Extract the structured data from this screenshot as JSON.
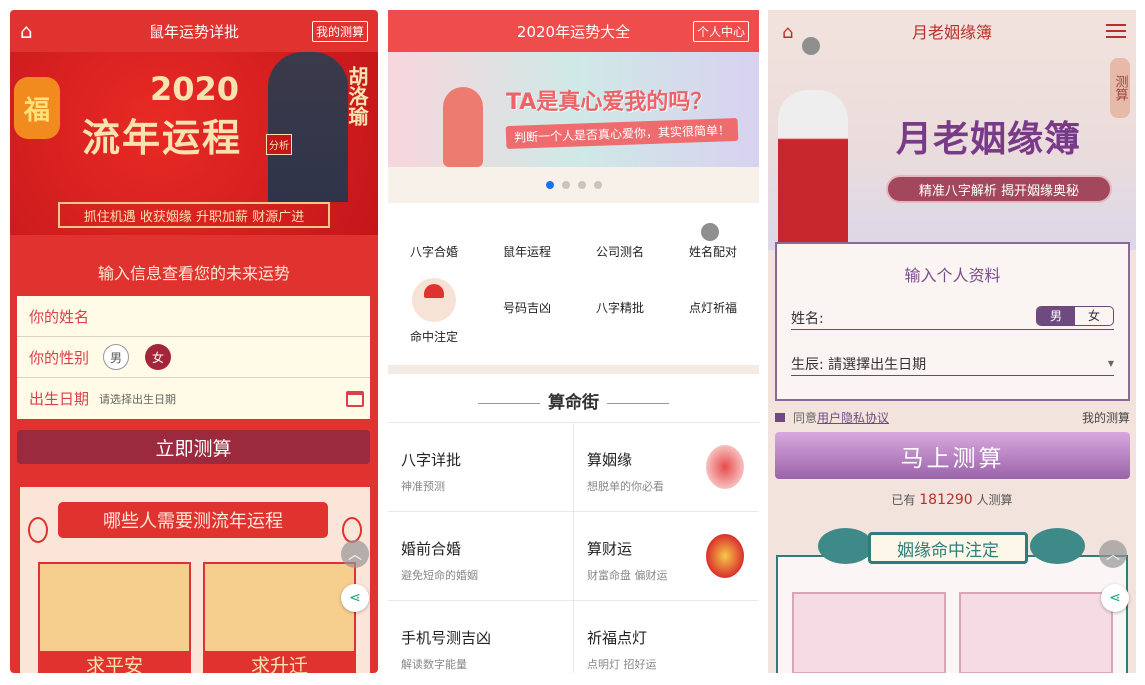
{
  "panel1": {
    "header": {
      "title": "鼠年运势详批",
      "right_button": "我的测算",
      "icon": "home-icon"
    },
    "banner": {
      "year": "2020",
      "title": "流年运程",
      "name": "胡洛瑜",
      "badge": "分析",
      "fu": "福",
      "slogan": "抓住机遇 收获姻缘 升职加薪 财源广进"
    },
    "form": {
      "title": "输入信息查看您的未来运势",
      "name_label": "你的姓名",
      "gender_label": "你的性别",
      "male": "男",
      "female": "女",
      "date_label": "出生日期",
      "date_placeholder": "请选择出生日期"
    },
    "submit": "立即测算",
    "section": {
      "title": "哪些人需要测流年运程",
      "cards": [
        "求平安",
        "求升迁"
      ]
    }
  },
  "panel2": {
    "header": {
      "title": "2020年运势大全",
      "right_button": "个人中心"
    },
    "banner": {
      "title": "TA是真心爱我的吗？",
      "subtitle": "判断一个人是否真心爱你，其实很简单！",
      "slides": 4,
      "active_slide": 1
    },
    "icons": [
      "八字合婚",
      "鼠年运程",
      "公司测名",
      "姓名配对",
      "命中注定",
      "号码吉凶",
      "八字精批",
      "点灯祈福"
    ],
    "street_title": "算命街",
    "items": [
      {
        "title": "八字详批",
        "sub": "神准预测"
      },
      {
        "title": "算姻缘",
        "sub": "想脱单的你必看"
      },
      {
        "title": "婚前合婚",
        "sub": "避免短命的婚姻"
      },
      {
        "title": "算财运",
        "sub": "财富命盘 偏财运"
      },
      {
        "title": "手机号测吉凶",
        "sub": "解读数字能量"
      },
      {
        "title": "祈福点灯",
        "sub": "点明灯 招好运"
      }
    ]
  },
  "panel3": {
    "header": {
      "title": "月老姻缘簿"
    },
    "banner": {
      "title": "月老姻缘簿",
      "subtitle": "精准八字解析  揭开姻缘奥秘",
      "side_button": "测算"
    },
    "form": {
      "title": "输入个人资料",
      "name_label": "姓名:",
      "male": "男",
      "female": "女",
      "date_label": "生辰: 請選擇出生日期"
    },
    "agree_prefix": "同意",
    "agree_link": "用户隐私协议",
    "my_tests": "我的测算",
    "submit": "马上测算",
    "count_prefix": "已有",
    "count": "181290",
    "count_suffix": "人测算",
    "section_title": "姻缘命中注定"
  }
}
